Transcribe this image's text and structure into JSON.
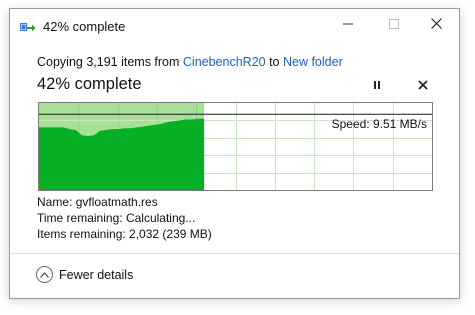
{
  "window": {
    "title": "42% complete",
    "controls": {
      "minimize": "minimize-icon",
      "maximize": "maximize-icon",
      "close": "close-icon"
    }
  },
  "copy": {
    "prefix": "Copying 3,191 items from ",
    "source": "CinebenchR20",
    "middle": " to ",
    "destination": "New folder"
  },
  "progress": {
    "heading": "42% complete",
    "percent": 42,
    "speed_label": "Speed: 9.51 MB/s",
    "speed_values": [
      0.72,
      0.72,
      0.72,
      0.72,
      0.72,
      0.7,
      0.69,
      0.63,
      0.62,
      0.63,
      0.68,
      0.69,
      0.7,
      0.7,
      0.71,
      0.71,
      0.72,
      0.73,
      0.74,
      0.75,
      0.76,
      0.78,
      0.79,
      0.8,
      0.81,
      0.81,
      0.82,
      0.82
    ],
    "current_speed_level": 0.87
  },
  "details": {
    "name_label": "Name:",
    "name_value": "gvfloatmath.res",
    "time_label": "Time remaining:",
    "time_value": "Calculating...",
    "items_label": "Items remaining:",
    "items_value": "2,032 (239 MB)"
  },
  "footer": {
    "fewer_details": "Fewer details",
    "icon": "chevron-up-icon"
  },
  "colors": {
    "progress_fill": "#a6e196",
    "speed_fill": "#06b025",
    "link": "#1a63b8",
    "grid": "#c8e6c0"
  }
}
